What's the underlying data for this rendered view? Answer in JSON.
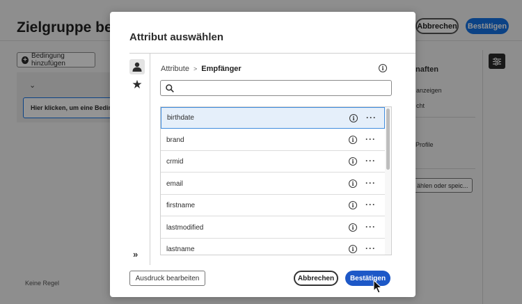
{
  "background": {
    "page_title": "Zielgruppe bearbe",
    "cancel_label": "Abbrechen",
    "confirm_label": "Bestätigen",
    "add_condition_label": "Bedingung hinzufügen",
    "click_hint": "Hier klicken, um eine Bedingung",
    "no_rule": "Keine Regel",
    "right_panel": {
      "heading": "naften",
      "line1": "anzeigen",
      "line2": "cht",
      "line3": "Profile",
      "select_button": "ählen oder speic..."
    }
  },
  "modal": {
    "title": "Attribut auswählen",
    "breadcrumb": {
      "root": "Attribute",
      "separator": ">",
      "current": "Empfänger"
    },
    "search": {
      "placeholder": "",
      "value": ""
    },
    "attributes": [
      {
        "label": "birthdate",
        "selected": true
      },
      {
        "label": "brand",
        "selected": false
      },
      {
        "label": "crmid",
        "selected": false
      },
      {
        "label": "email",
        "selected": false
      },
      {
        "label": "firstname",
        "selected": false
      },
      {
        "label": "lastmodified",
        "selected": false
      },
      {
        "label": "lastname",
        "selected": false
      }
    ],
    "expand_label": "»",
    "edit_expression_label": "Ausdruck bearbeiten",
    "cancel_label": "Abbrechen",
    "confirm_label": "Bestätigen"
  },
  "icons": {
    "info": "info-icon",
    "more": "more-icon",
    "person": "person-icon",
    "star": "star-icon",
    "search": "search-icon",
    "filter": "filter-settings-icon"
  },
  "colors": {
    "primary": "#1d58c7",
    "selected_row": "#e5effa",
    "selected_border": "#3f8cde"
  }
}
